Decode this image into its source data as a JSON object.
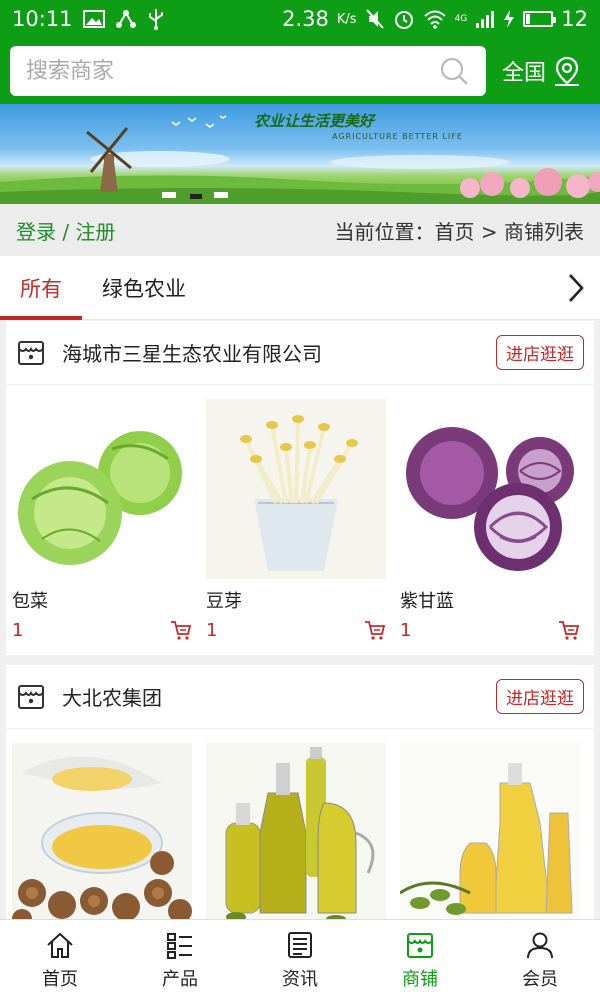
{
  "status_bar": {
    "time": "10:11",
    "network_speed": "2.38",
    "network_speed_unit": "K/s",
    "battery": "12",
    "signal_label": "4G"
  },
  "header": {
    "search_placeholder": "搜索商家",
    "region_label": "全国",
    "icons": {
      "search": "search-icon",
      "region": "location-pin-icon"
    },
    "colors": {
      "brand_green": "#0e9e16"
    }
  },
  "banner": {
    "slogan": "农业让生活更美好",
    "slogan_en": "AGRICULTURE BETTER LIFE"
  },
  "breadcrumb": {
    "login": "登录",
    "separator": " / ",
    "register": "注册",
    "position_prefix": "当前位置：",
    "home": "首页",
    "arrow": " > ",
    "current": "商铺列表"
  },
  "tabs": {
    "items": [
      {
        "label": "所有",
        "active": true
      },
      {
        "label": "绿色农业",
        "active": false
      }
    ],
    "next_icon": "chevron-right-icon",
    "accent_color": "#c62828"
  },
  "shops": [
    {
      "name": "海城市三星生态农业有限公司",
      "visit_label": "进店逛逛",
      "products": [
        {
          "name": "包菜",
          "price": "1",
          "image": "cabbage"
        },
        {
          "name": "豆芽",
          "price": "1",
          "image": "bean-sprouts"
        },
        {
          "name": "紫甘蓝",
          "price": "1",
          "image": "purple-cabbage"
        }
      ]
    },
    {
      "name": "大北农集团",
      "visit_label": "进店逛逛",
      "products": [
        {
          "name": "",
          "price": "",
          "image": "walnut-oil"
        },
        {
          "name": "",
          "price": "",
          "image": "olive-oil-bottles"
        },
        {
          "name": "",
          "price": "",
          "image": "olive-oil"
        }
      ]
    }
  ],
  "bottom_nav": {
    "items": [
      {
        "label": "首页",
        "icon": "home-icon",
        "active": false
      },
      {
        "label": "产品",
        "icon": "list-icon",
        "active": false
      },
      {
        "label": "资讯",
        "icon": "news-icon",
        "active": false
      },
      {
        "label": "商铺",
        "icon": "store-icon",
        "active": true
      },
      {
        "label": "会员",
        "icon": "user-icon",
        "active": false
      }
    ]
  }
}
